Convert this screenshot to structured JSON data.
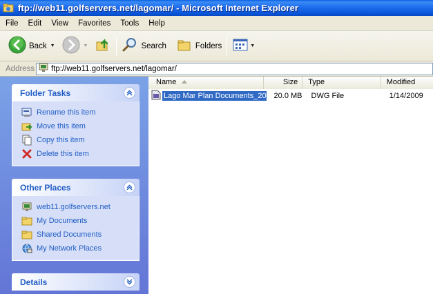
{
  "window": {
    "title": "ftp://web11.golfservers.net/lagomar/ - Microsoft Internet Explorer"
  },
  "menu": [
    "File",
    "Edit",
    "View",
    "Favorites",
    "Tools",
    "Help"
  ],
  "toolbar": {
    "back_label": "Back",
    "search_label": "Search",
    "folders_label": "Folders"
  },
  "address": {
    "label": "Address",
    "value": "ftp://web11.golfservers.net/lagomar/"
  },
  "folder_tasks": {
    "title": "Folder Tasks",
    "items": [
      {
        "label": "Rename this item",
        "icon": "rename-icon"
      },
      {
        "label": "Move this item",
        "icon": "move-icon"
      },
      {
        "label": "Copy this item",
        "icon": "copy-icon"
      },
      {
        "label": "Delete this item",
        "icon": "delete-icon"
      }
    ]
  },
  "other_places": {
    "title": "Other Places",
    "items": [
      {
        "label": "web11.golfservers.net",
        "icon": "ftp-site-icon"
      },
      {
        "label": "My Documents",
        "icon": "folder-icon"
      },
      {
        "label": "Shared Documents",
        "icon": "folder-icon"
      },
      {
        "label": "My Network Places",
        "icon": "network-icon"
      }
    ]
  },
  "details": {
    "title": "Details"
  },
  "columns": {
    "name": "Name",
    "size": "Size",
    "type": "Type",
    "modified": "Modified"
  },
  "files": [
    {
      "name": "Lago Mar Plan Documents_20...",
      "size": "20.0 MB",
      "type": "DWG File",
      "modified": "1/14/2009"
    }
  ],
  "colors": {
    "title_blue": "#0a5fe0",
    "link_blue": "#215dc6",
    "selection": "#316ac5"
  }
}
